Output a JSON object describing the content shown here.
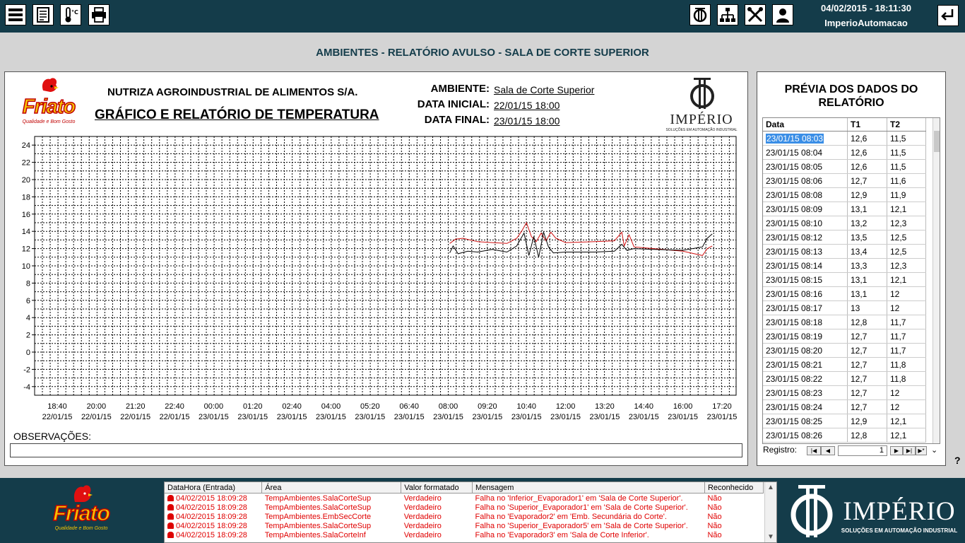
{
  "header": {
    "datetime": "04/02/2015 - 18:11:30",
    "username": "ImperioAutomacao",
    "left_icons": [
      "menu-icon",
      "report-icon",
      "thermometer-icon",
      "printer-icon"
    ],
    "right_icons": [
      "imperio-icon",
      "network-icon",
      "tools-icon",
      "user-icon"
    ],
    "back_icon": "return-icon"
  },
  "page_title": "AMBIENTES - RELATÓRIO AVULSO - SALA DE CORTE SUPERIOR",
  "report": {
    "logo_text": "Friato",
    "logo_slogan": "Qualidade e Bom Gosto",
    "company": "NUTRIZA AGROINDUSTRIAL DE ALIMENTOS S/A.",
    "title": "GRÁFICO E RELATÓRIO DE TEMPERATURA",
    "ambiente_label": "AMBIENTE:",
    "ambiente_value": "Sala de Corte Superior",
    "data_inicial_label": "DATA INICIAL:",
    "data_inicial_value": "22/01/15 18:00",
    "data_final_label": "DATA FINAL:",
    "data_final_value": "23/01/15 18:00",
    "imperio_name": "IMPÉRIO",
    "imperio_slogan": "SOLUÇÕES EM AUTOMAÇÃO INDUSTRIAL",
    "observacoes_label": "OBSERVAÇÕES:"
  },
  "chart_data": {
    "type": "line",
    "ylim": [
      -5,
      25
    ],
    "yticks": [
      -4,
      -2,
      0,
      2,
      4,
      6,
      8,
      10,
      12,
      14,
      16,
      18,
      20,
      22,
      24
    ],
    "xticks": [
      {
        "time": "18:40",
        "date": "22/01/15"
      },
      {
        "time": "20:00",
        "date": "22/01/15"
      },
      {
        "time": "21:20",
        "date": "22/01/15"
      },
      {
        "time": "22:40",
        "date": "22/01/15"
      },
      {
        "time": "00:00",
        "date": "23/01/15"
      },
      {
        "time": "01:20",
        "date": "23/01/15"
      },
      {
        "time": "02:40",
        "date": "23/01/15"
      },
      {
        "time": "04:00",
        "date": "23/01/15"
      },
      {
        "time": "05:20",
        "date": "23/01/15"
      },
      {
        "time": "06:40",
        "date": "23/01/15"
      },
      {
        "time": "08:00",
        "date": "23/01/15"
      },
      {
        "time": "09:20",
        "date": "23/01/15"
      },
      {
        "time": "10:40",
        "date": "23/01/15"
      },
      {
        "time": "12:00",
        "date": "23/01/15"
      },
      {
        "time": "13:20",
        "date": "23/01/15"
      },
      {
        "time": "14:40",
        "date": "23/01/15"
      },
      {
        "time": "16:00",
        "date": "23/01/15"
      },
      {
        "time": "17:20",
        "date": "23/01/15"
      }
    ],
    "grid": true,
    "series": [
      {
        "color": "#d01010",
        "x": [
          "23/01/15 08:03",
          "23/01/15 08:15",
          "23/01/15 08:30",
          "23/01/15 09:00",
          "23/01/15 09:30",
          "23/01/15 10:00",
          "23/01/15 10:20",
          "23/01/15 10:30",
          "23/01/15 10:40",
          "23/01/15 10:50",
          "23/01/15 11:00",
          "23/01/15 11:10",
          "23/01/15 11:20",
          "23/01/15 11:30",
          "23/01/15 11:40",
          "23/01/15 12:00",
          "23/01/15 13:00",
          "23/01/15 13:40",
          "23/01/15 13:55",
          "23/01/15 14:00",
          "23/01/15 14:10",
          "23/01/15 14:20",
          "23/01/15 15:00",
          "23/01/15 16:00",
          "23/01/15 16:40",
          "23/01/15 16:50",
          "23/01/15 17:00"
        ],
        "y": [
          12.6,
          13.1,
          13.2,
          12.8,
          12.7,
          12.6,
          13.2,
          14.0,
          15.0,
          13.4,
          12.8,
          13.8,
          12.9,
          13.9,
          13.2,
          12.7,
          12.8,
          12.9,
          13.9,
          12.3,
          13.6,
          12.2,
          12.0,
          11.7,
          11.2,
          12.0,
          12.3
        ]
      },
      {
        "color": "#000000",
        "x": [
          "23/01/15 08:03",
          "23/01/15 08:10",
          "23/01/15 08:20",
          "23/01/15 08:40",
          "23/01/15 09:00",
          "23/01/15 09:30",
          "23/01/15 10:00",
          "23/01/15 10:20",
          "23/01/15 10:35",
          "23/01/15 10:45",
          "23/01/15 10:55",
          "23/01/15 11:05",
          "23/01/15 11:15",
          "23/01/15 11:25",
          "23/01/15 11:35",
          "23/01/15 12:00",
          "23/01/15 13:00",
          "23/01/15 13:40",
          "23/01/15 13:55",
          "23/01/15 14:05",
          "23/01/15 14:20",
          "23/01/15 15:00",
          "23/01/15 16:00",
          "23/01/15 16:40",
          "23/01/15 16:50",
          "23/01/15 17:00"
        ],
        "y": [
          11.5,
          12.3,
          11.4,
          11.7,
          11.6,
          11.9,
          11.6,
          12.3,
          13.8,
          11.2,
          13.4,
          11.0,
          13.9,
          12.2,
          11.5,
          11.6,
          11.6,
          11.7,
          12.5,
          11.8,
          12.0,
          11.9,
          11.8,
          12.2,
          13.2,
          13.7
        ]
      }
    ]
  },
  "preview": {
    "title_line1": "PRÉVIA DOS DADOS DO",
    "title_line2": "RELATÓRIO",
    "columns": [
      "Data",
      "T1",
      "T2"
    ],
    "rows": [
      [
        "23/01/15 08:03",
        "12,6",
        "11,5"
      ],
      [
        "23/01/15 08:04",
        "12,6",
        "11,5"
      ],
      [
        "23/01/15 08:05",
        "12,6",
        "11,5"
      ],
      [
        "23/01/15 08:06",
        "12,7",
        "11,6"
      ],
      [
        "23/01/15 08:08",
        "12,9",
        "11,9"
      ],
      [
        "23/01/15 08:09",
        "13,1",
        "12,1"
      ],
      [
        "23/01/15 08:10",
        "13,2",
        "12,3"
      ],
      [
        "23/01/15 08:12",
        "13,5",
        "12,5"
      ],
      [
        "23/01/15 08:13",
        "13,4",
        "12,5"
      ],
      [
        "23/01/15 08:14",
        "13,3",
        "12,3"
      ],
      [
        "23/01/15 08:15",
        "13,1",
        "12,1"
      ],
      [
        "23/01/15 08:16",
        "13,1",
        "12"
      ],
      [
        "23/01/15 08:17",
        "13",
        "12"
      ],
      [
        "23/01/15 08:18",
        "12,8",
        "11,7"
      ],
      [
        "23/01/15 08:19",
        "12,7",
        "11,7"
      ],
      [
        "23/01/15 08:20",
        "12,7",
        "11,7"
      ],
      [
        "23/01/15 08:21",
        "12,7",
        "11,8"
      ],
      [
        "23/01/15 08:22",
        "12,7",
        "11,8"
      ],
      [
        "23/01/15 08:23",
        "12,7",
        "12"
      ],
      [
        "23/01/15 08:24",
        "12,7",
        "12"
      ],
      [
        "23/01/15 08:25",
        "12,9",
        "12,1"
      ],
      [
        "23/01/15 08:26",
        "12,8",
        "12,1"
      ]
    ],
    "registro_label": "Registro:",
    "registro_value": "1"
  },
  "help_label": "?",
  "alarms": {
    "columns": [
      "DataHora (Entrada)",
      "Área",
      "Valor formatado",
      "Mensagem",
      "Reconhecido"
    ],
    "rows": [
      [
        "04/02/2015 18:09:28",
        "TempAmbientes.SalaCorteSup",
        "Verdadeiro",
        "Falha no 'Inferior_Evaporador1' em 'Sala de Corte Superior'.",
        "Não"
      ],
      [
        "04/02/2015 18:09:28",
        "TempAmbientes.SalaCorteSup",
        "Verdadeiro",
        "Falha no 'Superior_Evaporador1' em 'Sala de Corte Superior'.",
        "Não"
      ],
      [
        "04/02/2015 18:09:28",
        "TempAmbientes.EmbSecCorte",
        "Verdadeiro",
        "Falha no 'Evaporador2' em 'Emb. Secundária do Corte'.",
        "Não"
      ],
      [
        "04/02/2015 18:09:28",
        "TempAmbientes.SalaCorteSup",
        "Verdadeiro",
        "Falha no 'Superior_Evaporador5' em 'Sala de Corte Superior'.",
        "Não"
      ],
      [
        "04/02/2015 18:09:28",
        "TempAmbientes.SalaCorteInf",
        "Verdadeiro",
        "Falha no 'Evaporador3' em 'Sala de Corte Inferior'.",
        "Não"
      ]
    ]
  },
  "footer": {
    "friato_text": "Friato",
    "friato_slogan": "Qualidade e Bom Gosto",
    "imperio_name": "IMPÉRIO",
    "imperio_slogan": "SOLUÇÕES EM AUTOMAÇÃO INDUSTRIAL"
  },
  "colors": {
    "bar": "#143c4a",
    "alarm": "#e00000",
    "logo_red": "#e01010",
    "logo_yellow": "#f5c400"
  }
}
